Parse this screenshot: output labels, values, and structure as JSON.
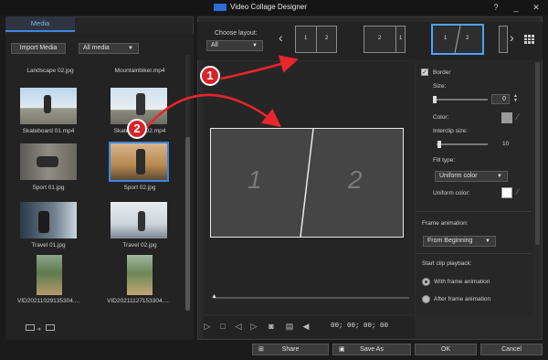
{
  "window": {
    "title": "Video Collage Designer",
    "help": "?",
    "minimize": "_",
    "close": "✕"
  },
  "media_panel": {
    "tab": "Media",
    "import_button": "Import Media",
    "filter_value": "All media",
    "items": [
      {
        "caption": "Landscape 02.jpg"
      },
      {
        "caption": "Mountainbiker.mp4"
      },
      {
        "caption": "Skateboard 01.mp4"
      },
      {
        "caption": "Skateboard 02.mp4"
      },
      {
        "caption": "Sport 01.jpg"
      },
      {
        "caption": "Sport 02.jpg"
      },
      {
        "caption": "Travel 01.jpg"
      },
      {
        "caption": "Travel 02.jpg"
      },
      {
        "caption": "VID20211029135304...."
      },
      {
        "caption": "VID20211127153304...."
      }
    ]
  },
  "layout_chooser": {
    "label": "Choose layout:",
    "filter_value": "All",
    "layouts": [
      {
        "left": "1",
        "right": "2"
      },
      {
        "left": "2",
        "right": "1"
      },
      {
        "left": "1",
        "right": "2"
      }
    ]
  },
  "canvas": {
    "cell1": "1",
    "cell2": "2"
  },
  "playback": {
    "timecode": "00; 00; 00; 00"
  },
  "properties": {
    "border_label": "Border",
    "size_label": "Size:",
    "size_value": "0",
    "color_label": "Color:",
    "interclip_label": "Interclip size:",
    "interclip_value": "10",
    "fill_type_label": "Fill type:",
    "fill_type_value": "Uniform color",
    "uniform_color_label": "Uniform color:",
    "frame_animation_label": "Frame animation:",
    "frame_animation_value": "From Beginning",
    "start_clip_label": "Start clip playback:",
    "radio_with": "With frame animation",
    "radio_after": "After frame animation"
  },
  "bottom_bar": {
    "share": "Share",
    "save_as": "Save As",
    "ok": "OK",
    "cancel": "Cancel"
  },
  "annotations": {
    "step1": "1",
    "step2": "2",
    "arrow_color": "#e8262c"
  }
}
